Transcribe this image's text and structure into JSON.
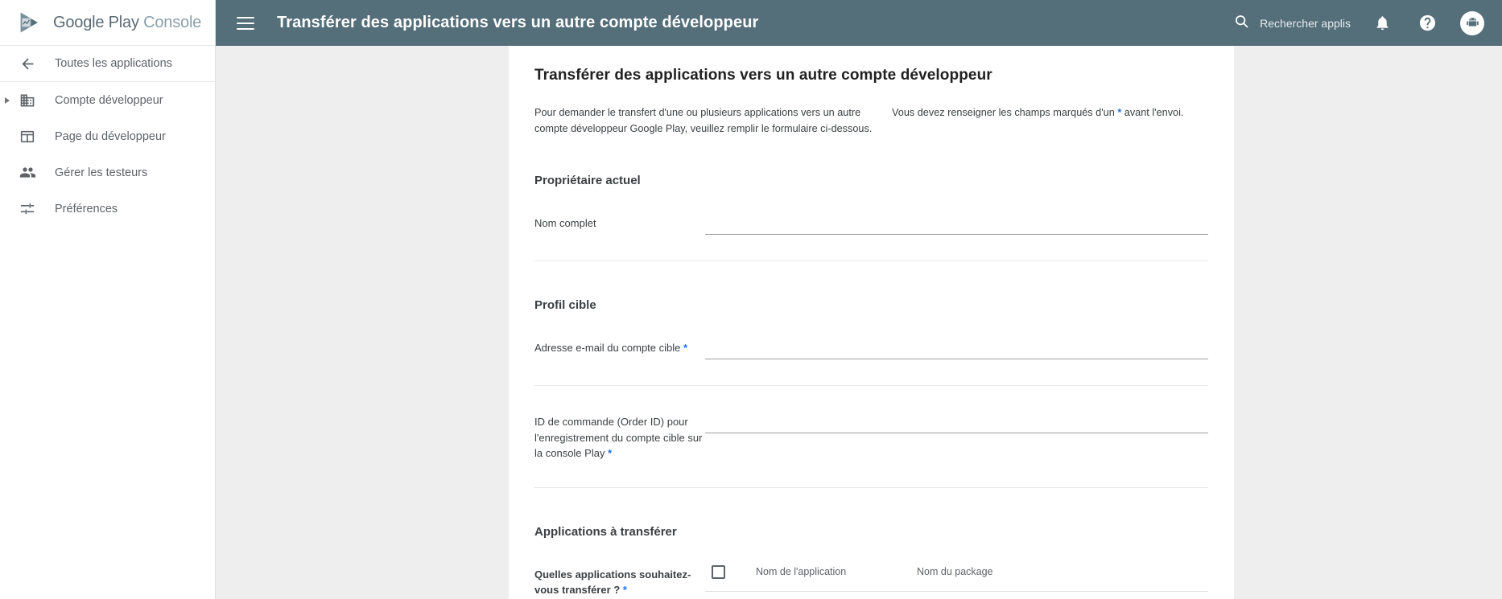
{
  "brand": {
    "name_strong": "Google Play",
    "name_light": "Console",
    "logo_icon": "play-console-logo"
  },
  "topbar": {
    "menu_icon": "hamburger-menu-icon",
    "title": "Transférer des applications vers un autre compte développeur",
    "search": {
      "icon": "search-icon",
      "label": "Rechercher applis"
    },
    "notifications_icon": "bell-icon",
    "help_icon": "help-circle-icon",
    "account_icon": "android-avatar-icon",
    "background_color": "#546e7a"
  },
  "sidebar": {
    "items": [
      {
        "label": "Toutes les applications",
        "icon": "arrow-back-icon",
        "expandable": false
      },
      {
        "label": "Compte développeur",
        "icon": "domain-building-icon",
        "expandable": true
      },
      {
        "label": "Page du développeur",
        "icon": "web-page-icon",
        "expandable": false
      },
      {
        "label": "Gérer les testeurs",
        "icon": "people-group-icon",
        "expandable": false
      },
      {
        "label": "Préférences",
        "icon": "tune-sliders-icon",
        "expandable": false
      }
    ]
  },
  "card": {
    "title": "Transférer des applications vers un autre compte développeur",
    "intro": "Pour demander le transfert d'une ou plusieurs applications vers un autre compte développeur Google Play, veuillez remplir le formulaire ci-dessous.",
    "required_note_before": "Vous devez renseigner les champs marqués d'un",
    "required_marker": "*",
    "required_note_after": "avant l'envoi.",
    "accent_color": "#1a73e8",
    "sections": [
      {
        "title": "Propriétaire actuel",
        "fields": [
          {
            "label": "Nom complet",
            "required": false,
            "value": "",
            "placeholder": ""
          }
        ]
      },
      {
        "title": "Profil cible",
        "fields": [
          {
            "label": "Adresse e-mail du compte cible",
            "required": true,
            "value": "",
            "placeholder": ""
          },
          {
            "label": "ID de commande (Order ID) pour l'enregistrement du compte cible sur la console Play",
            "required": true,
            "value": "",
            "placeholder": ""
          }
        ]
      }
    ],
    "apps_section": {
      "title": "Applications à transférer",
      "question_label": "Quelles applications souhaitez-vous transférer ?",
      "question_required": true,
      "select_all_checkbox": "select-all-checkbox",
      "columns": [
        "Nom de l'application",
        "Nom du package"
      ],
      "rows": []
    }
  }
}
